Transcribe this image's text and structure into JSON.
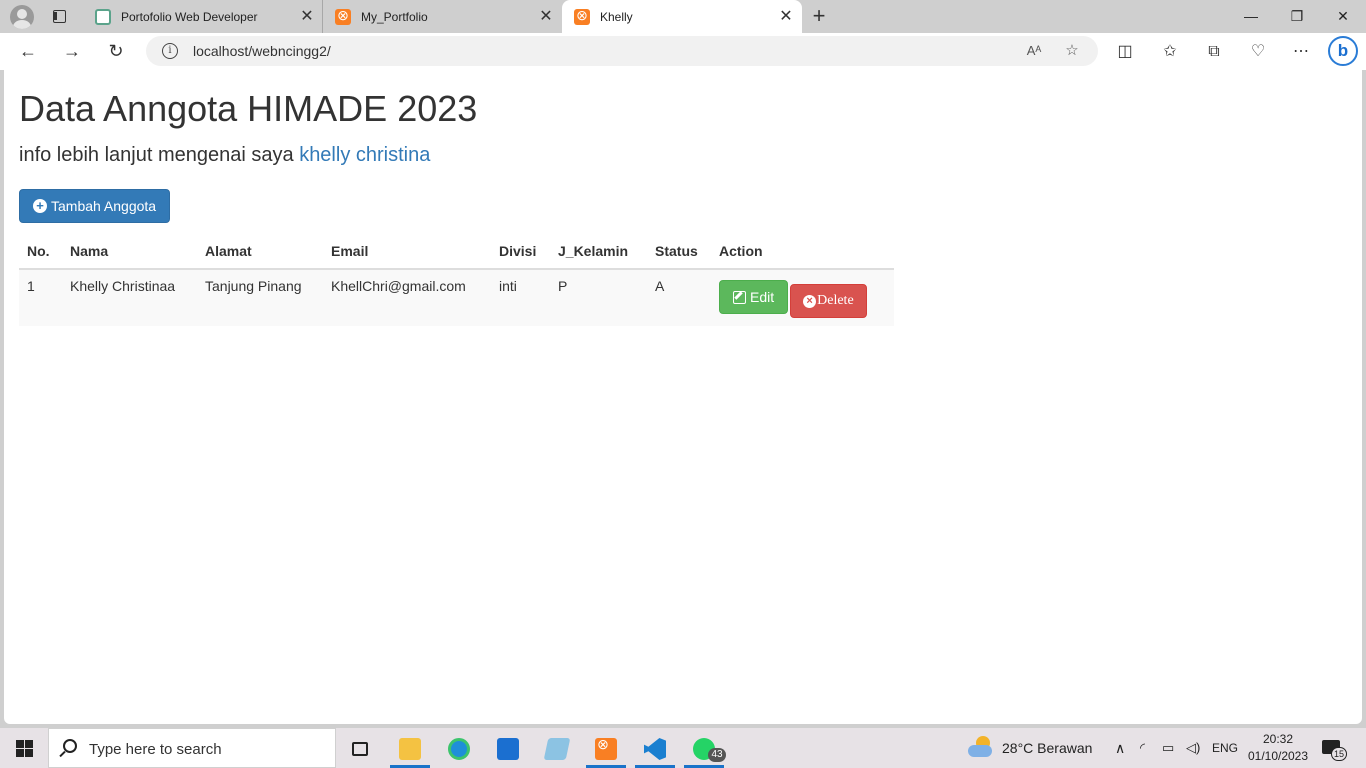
{
  "browser": {
    "tabs": [
      {
        "label": "Portofolio Web Developer",
        "icon": "chatgpt-icon"
      },
      {
        "label": "My_Portfolio",
        "icon": "xampp-icon"
      },
      {
        "label": "Khelly",
        "icon": "xampp-icon",
        "active": true
      }
    ],
    "close_glyph": "✕",
    "new_tab_glyph": "+",
    "url": "localhost/webncingg2/",
    "read_aloud_glyph": "Aᴬ",
    "window_controls": {
      "minimize": "—",
      "restore": "❐",
      "close": "✕"
    },
    "nav": {
      "back": "←",
      "forward": "→",
      "refresh": "↻"
    },
    "toolbar": {
      "split": "◫",
      "favorites": "✩",
      "favorite_star": "☆",
      "collections": "⧉",
      "performance": "♡",
      "more": "⋯",
      "bing": "b"
    }
  },
  "page": {
    "title": "Data Anngota HIMADE 2023",
    "subtitle_prefix": "info lebih lanjut mengenai saya ",
    "subtitle_link": "khelly christina",
    "add_button": "Tambah Anggota",
    "table": {
      "headers": [
        "No.",
        "Nama",
        "Alamat",
        "Email",
        "Divisi",
        "J_Kelamin",
        "Status",
        "Action"
      ],
      "rows": [
        {
          "no": "1",
          "nama": "Khelly Christinaa",
          "alamat": "Tanjung Pinang",
          "email": "KhellChri@gmail.com",
          "divisi": "inti",
          "jk": "P",
          "status": "A",
          "edit_label": "Edit",
          "delete_label": "Delete"
        }
      ]
    }
  },
  "taskbar": {
    "search_placeholder": "Type here to search",
    "weather": "28°C  Berawan",
    "language": "ENG",
    "time": "20:32",
    "date": "01/10/2023",
    "notifications": "15",
    "whatsapp_badge": "43",
    "tray_glyphs": {
      "chevron": "∧",
      "wifi": "◜",
      "battery": "▭",
      "volume": "◁)"
    }
  },
  "colors": {
    "primary": "#337ab7",
    "success": "#5cb85c",
    "danger": "#d9534f",
    "xampp": "#f97f23"
  }
}
